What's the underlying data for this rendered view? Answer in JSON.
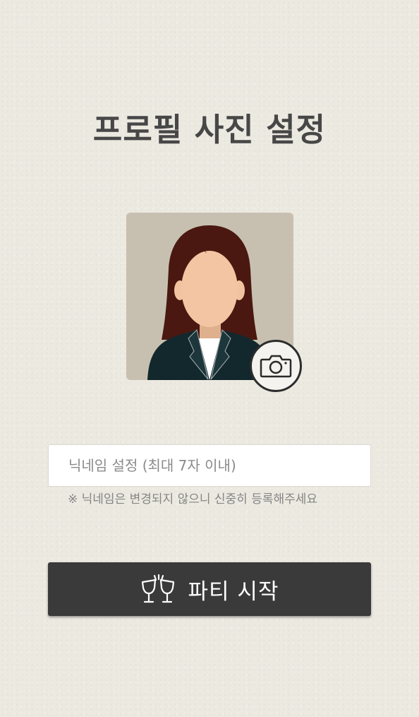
{
  "page": {
    "title": "프로필 사진 설정"
  },
  "profile": {
    "avatar": "female-avatar-placeholder",
    "camera_icon": "camera-icon"
  },
  "nickname": {
    "placeholder": "닉네임 설정 (최대 7자 이내)",
    "value": "",
    "notice": "※ 닉네임은 변경되지 않으니 신중히 등록해주세요"
  },
  "start_button": {
    "icon": "cheers-glasses-icon",
    "label": "파티 시작"
  },
  "colors": {
    "background": "#ece9e1",
    "title": "#474747",
    "button": "#3a3a3a",
    "avatar_bg": "#c7c0b0",
    "hair": "#4a1810",
    "suit": "#13282d"
  }
}
